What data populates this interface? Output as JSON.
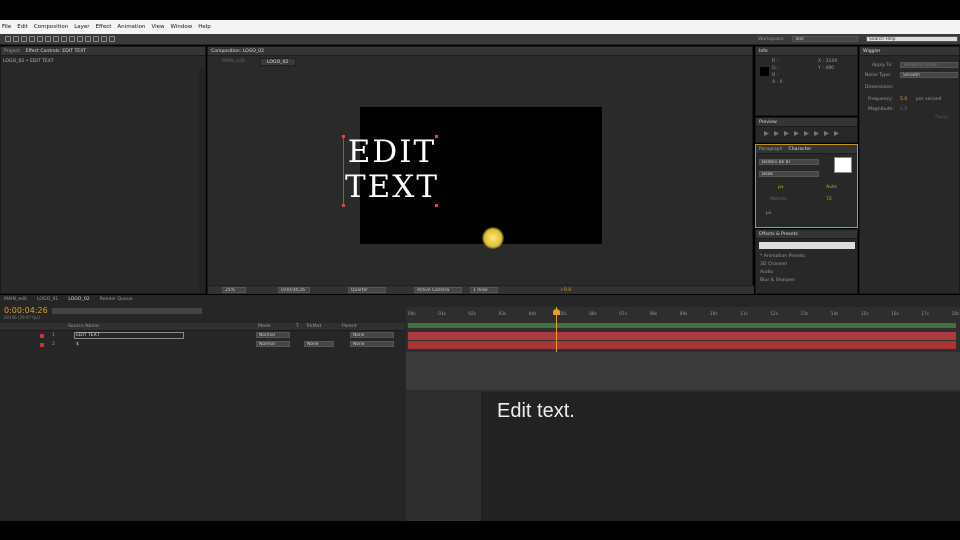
{
  "menu": [
    "File",
    "Edit",
    "Composition",
    "Layer",
    "Effect",
    "Animation",
    "View",
    "Window",
    "Help"
  ],
  "workspace": {
    "label": "Workspace:",
    "value": "Text",
    "search_placeholder": "Search Help"
  },
  "project_panel": {
    "tab_project": "Project",
    "tab_effect_controls": "Effect Controls: EDIT TEXT",
    "breadcrumb": "LOGO_02 • EDIT TEXT"
  },
  "comp_panel": {
    "tab": "Composition: LOGO_02",
    "nav1": "MAIN_edit",
    "nav2": "LOGO_02",
    "line1": "EDIT",
    "line2": "TEXT",
    "zoom": "25%",
    "timecode": "0;00;04;26",
    "resolution": "Quarter",
    "camera": "Active Camera",
    "views": "1 View",
    "offset": "+0.0"
  },
  "info": {
    "title": "Info",
    "r": "R :",
    "g": "G :",
    "b": "B :",
    "a": "A : 0",
    "x": "X : 3109",
    "y": "Y : 480"
  },
  "wiggler": {
    "title": "Wiggler",
    "apply_label": "Apply To:",
    "apply_value": "Temporal Graph",
    "noise_label": "Noise Type:",
    "noise_value": "Smooth",
    "dimensions_label": "Dimensions:",
    "frequency_label": "Frequency:",
    "frequency_value": "5.0",
    "frequency_unit": "per second",
    "magnitude_label": "Magnitude:",
    "magnitude_value": "1.0",
    "apply_button": "Apply"
  },
  "preview": {
    "title": "Preview"
  },
  "character": {
    "tab_paragraph": "Paragraph",
    "tab_character": "Character",
    "font": "Bodoni Bk BT",
    "style": "Book",
    "size": "px",
    "leading": "Auto",
    "kerning": "Metrics",
    "tracking": "72",
    "stroke": "px"
  },
  "effects": {
    "title": "Effects & Presets",
    "items": [
      "* Animation Presets",
      "3D Channel",
      "Audio",
      "Blur & Sharpen"
    ]
  },
  "timeline": {
    "tabs": [
      "MAIN_edit",
      "LOGO_01",
      "LOGO_02",
      "Render Queue"
    ],
    "timecode": "0:00:04:26",
    "fps": "00146 (29.97 fps)",
    "col_source": "Source Name",
    "col_mode": "Mode",
    "col_t": "T",
    "col_trkmat": "TrkMat",
    "col_parent": "Parent",
    "layers": [
      {
        "num": "1",
        "name": "EDIT TEXT",
        "mode": "Normal",
        "trkmat": "",
        "parent": "None"
      },
      {
        "num": "2",
        "name": "$",
        "mode": "Normal",
        "trkmat": "None",
        "parent": "None"
      }
    ],
    "ruler": [
      "00s",
      "01s",
      "02s",
      "03s",
      "04s",
      "05s",
      "06s",
      "07s",
      "08s",
      "09s",
      "10s",
      "11s",
      "12s",
      "13s",
      "14s",
      "15s",
      "16s",
      "17s",
      "18s"
    ]
  },
  "caption": "Edit text."
}
